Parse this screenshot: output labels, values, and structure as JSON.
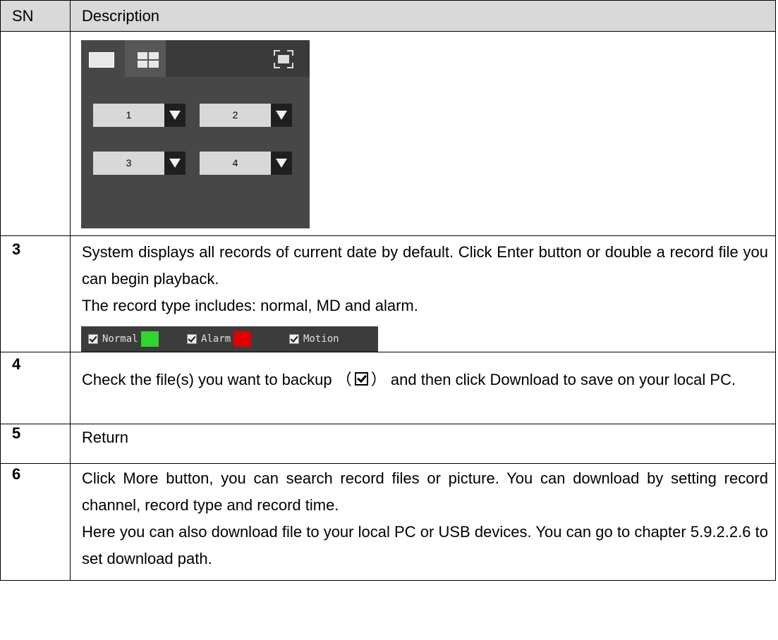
{
  "table": {
    "header": {
      "sn": "SN",
      "description": "Description"
    },
    "rows": [
      {
        "sn": "",
        "panel": {
          "tabs": [
            "single-window-icon",
            "quad-window-icon"
          ],
          "fullscreen_icon": "fullscreen-icon",
          "channels": [
            "1",
            "2",
            "3",
            "4"
          ],
          "colors": {
            "panel_bg": "#474747",
            "tabbar_bg": "#3a3a3a",
            "dropdown_bg": "#d8d8d8",
            "arrow_bg": "#1f1f1f"
          }
        }
      },
      {
        "sn": "3",
        "lines": [
          "System displays all records of current date by default. Click Enter button or double a record file you can begin playback.",
          "The record type includes: normal, MD and alarm."
        ],
        "legend": [
          {
            "label": "Normal",
            "color": "#2fd62f"
          },
          {
            "label": "Alarm",
            "color": "#e00000"
          },
          {
            "label": "Motion",
            "color": ""
          }
        ]
      },
      {
        "sn": "4",
        "text_before": "Check the file(s) you want to backup",
        "text_after": "and then click Download to save on your local PC.",
        "paren_open": "（",
        "paren_close": "）",
        "icon": "checkbox-checked-icon"
      },
      {
        "sn": "5",
        "text": "Return"
      },
      {
        "sn": "6",
        "lines": [
          "Click More button, you can search record files or picture. You can download by setting record channel, record type and record time.",
          "Here you can also download file to your local PC or USB devices. You can go to chapter 5.9.2.2.6 to set download path."
        ]
      }
    ]
  }
}
